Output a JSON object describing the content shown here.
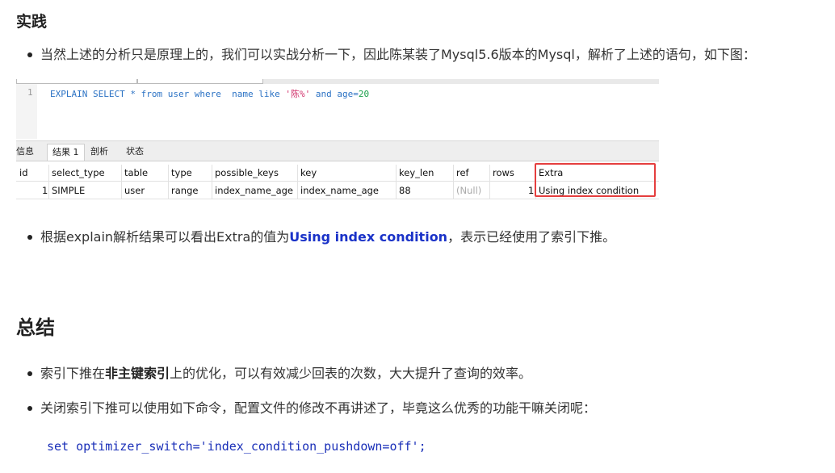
{
  "section_practice": {
    "title": "实践",
    "bullet1": "当然上述的分析只是原理上的，我们可以实战分析一下，因此陈某装了Mysql5.6版本的Mysql，解析了上述的语句，如下图："
  },
  "screenshot": {
    "line_number": "1",
    "code": {
      "explain_select": "EXPLAIN SELECT",
      "star_from_user_where": " * from user where  name like ",
      "like_value": "'陈%'",
      "and_age": " and age=",
      "age_value": "20"
    },
    "tabs": [
      "信息",
      "结果 1",
      "剖析",
      "状态"
    ],
    "columns": [
      "id",
      "select_type",
      "table",
      "type",
      "possible_keys",
      "key",
      "key_len",
      "ref",
      "rows",
      "Extra"
    ],
    "row": [
      "1",
      "SIMPLE",
      "user",
      "range",
      "index_name_age",
      "index_name_age",
      "88",
      "(Null)",
      "1",
      "Using index condition"
    ],
    "highlight_color": "#e53e3e"
  },
  "bullet2": {
    "prefix": "根据explain解析结果可以看出Extra的值为",
    "highlight": "Using index condition",
    "suffix": "，表示已经使用了索引下推。",
    "highlight_color": "#1a32c8"
  },
  "section_summary": {
    "title": "总结",
    "bullet1_prefix": "索引下推在",
    "bullet1_bold": "非主键索引",
    "bullet1_suffix": "上的优化，可以有效减少回表的次数，大大提升了查询的效率。",
    "bullet2": "关闭索引下推可以使用如下命令，配置文件的修改不再讲述了，毕竟这么优秀的功能干嘛关闭呢："
  },
  "code_block": {
    "text": "set optimizer_switch='index_condition_pushdown=off';"
  }
}
